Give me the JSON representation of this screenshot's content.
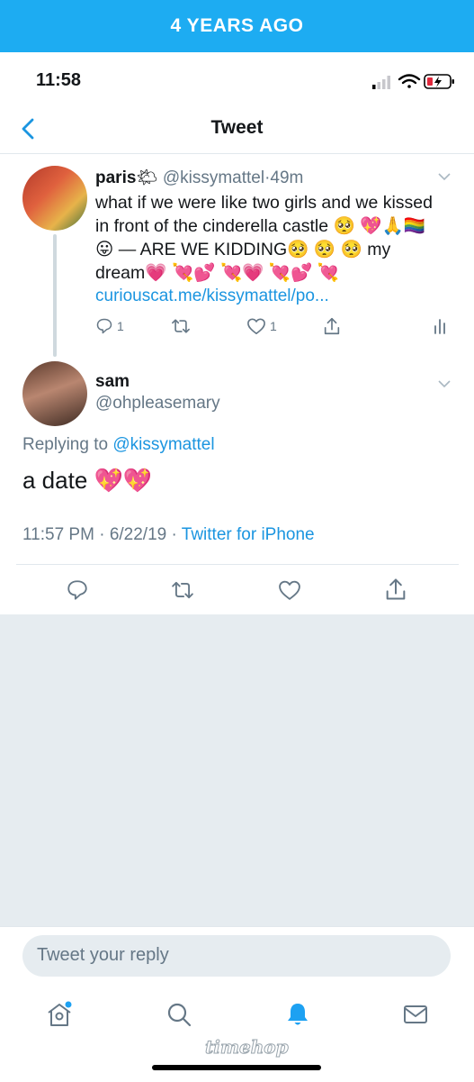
{
  "banner": {
    "text": "4 YEARS AGO"
  },
  "status_bar": {
    "time": "11:58"
  },
  "nav": {
    "title": "Tweet"
  },
  "parent_tweet": {
    "name": "paris",
    "name_emoji": "🌤",
    "handle": "@kissymattel",
    "separator": "·",
    "age": "49m",
    "text": "what if we were like two girls and we kissed in front of the cinderella castle 🥺 💖🙏🏳️‍🌈😛 — ARE WE KIDDING🥺 🥺 🥺 my dream💗 💘💕 💘💗 💘💕 💘",
    "link": "curiouscat.me/kissymattel/po...",
    "reply_count": "1",
    "like_count": "1"
  },
  "main_tweet": {
    "name": "sam",
    "handle": "@ohpleasemary",
    "replying_label": "Replying to",
    "replying_handle": "@kissymattel",
    "text": "a date 💖💖",
    "time": "11:57 PM",
    "date": "6/22/19",
    "dot": "·",
    "source": "Twitter for iPhone"
  },
  "composer": {
    "placeholder": "Tweet your reply"
  },
  "watermark": {
    "text": "timehop"
  },
  "colors": {
    "accent": "#1dacf2",
    "link": "#1b95e0",
    "muted": "#657786",
    "background_gray": "#e6ecf0"
  }
}
